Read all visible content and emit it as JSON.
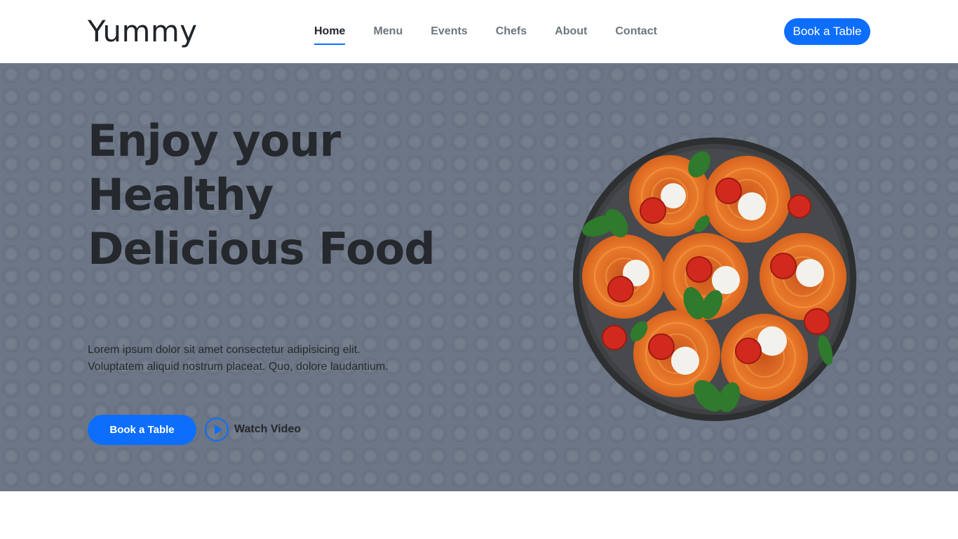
{
  "header": {
    "logo": "Yummy",
    "nav": [
      "Home",
      "Menu",
      "Events",
      "Chefs",
      "About",
      "Contact"
    ],
    "active": "Home",
    "cta": "Book a Table"
  },
  "hero": {
    "title": "Enjoy your Healthy Delicious Food",
    "text": "Lorem ipsum dolor sit amet consectetur adipisicing elit. Voluptatem aliquid nostrum placeat. Quo, dolore laudantium.",
    "cta": "Book a Table",
    "video_label": "Watch Video"
  },
  "colors": {
    "accent": "#0d6efd",
    "hero_bg": "#6c7686",
    "heading": "#25282c"
  },
  "icons": {
    "play": "play-circle-icon"
  }
}
